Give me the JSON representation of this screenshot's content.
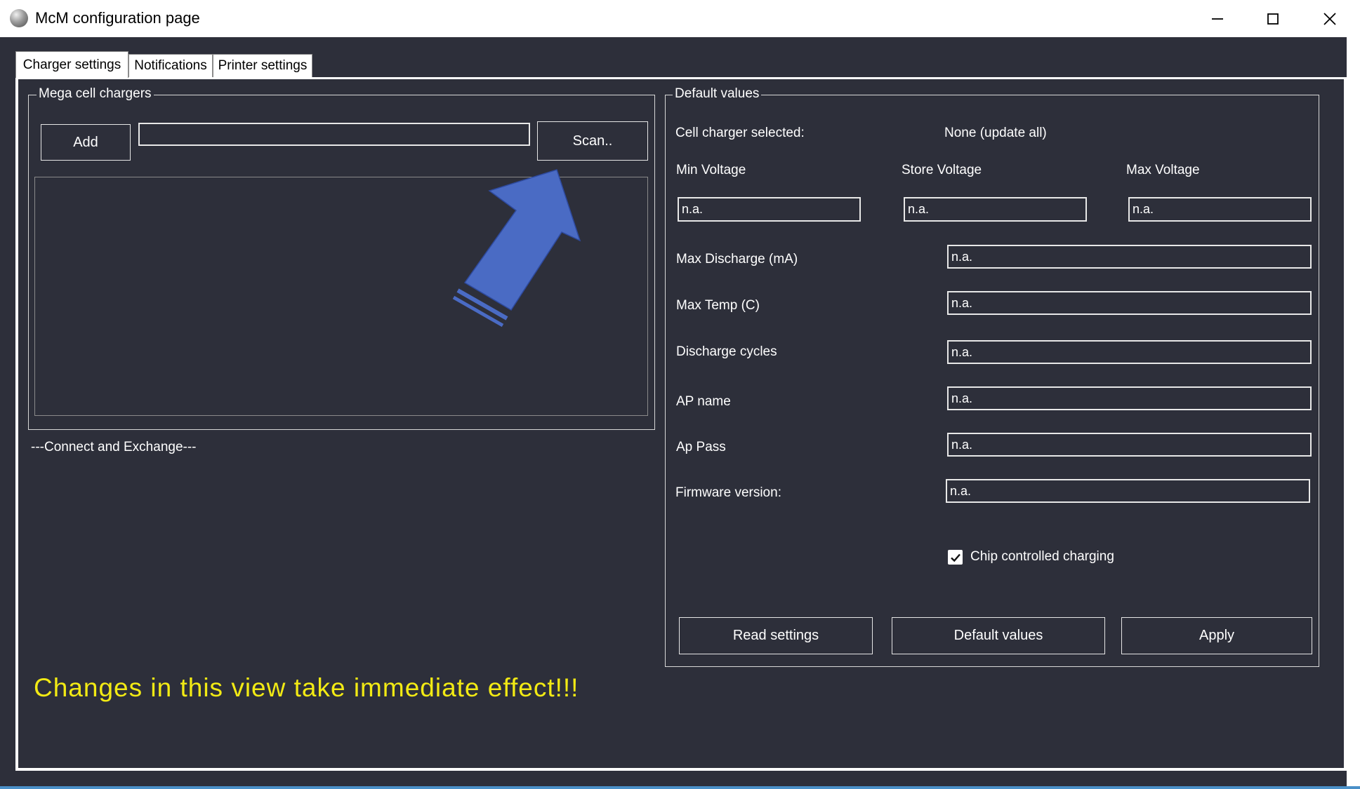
{
  "window": {
    "title": "McM configuration page",
    "controls": {
      "minimize": "minimize",
      "maximize": "maximize",
      "close": "close"
    }
  },
  "tabs": [
    {
      "label": "Charger settings",
      "active": true
    },
    {
      "label": "Notifications",
      "active": false
    },
    {
      "label": "Printer settings",
      "active": false
    }
  ],
  "chargers": {
    "group_title": "Mega cell chargers",
    "add_label": "Add",
    "address_value": "",
    "scan_label": "Scan..",
    "items": []
  },
  "status_text": "---Connect and Exchange---",
  "warning_text": "Changes in this view take immediate effect!!!",
  "defaults": {
    "group_title": "Default values",
    "selected_label": "Cell charger selected:",
    "selected_value": "None (update all)",
    "min_voltage_label": "Min Voltage",
    "store_voltage_label": "Store Voltage",
    "max_voltage_label": "Max Voltage",
    "min_voltage": "n.a.",
    "store_voltage": "n.a.",
    "max_voltage": "n.a.",
    "fields": [
      {
        "label": "Max Discharge (mA)",
        "value": "n.a."
      },
      {
        "label": "Max Temp (C)",
        "value": "n.a."
      },
      {
        "label": "Discharge cycles",
        "value": "n.a."
      },
      {
        "label": "AP name",
        "value": "n.a."
      },
      {
        "label": "Ap Pass",
        "value": "n.a."
      },
      {
        "label": "Firmware version:",
        "value": "n.a."
      }
    ],
    "chip_controlled_label": "Chip controlled charging",
    "chip_controlled_checked": true,
    "read_label": "Read settings",
    "default_label": "Default values",
    "apply_label": "Apply"
  },
  "colors": {
    "background": "#2d2f3a",
    "warning": "#f2ea14",
    "arrow": "#4a6bc4"
  }
}
